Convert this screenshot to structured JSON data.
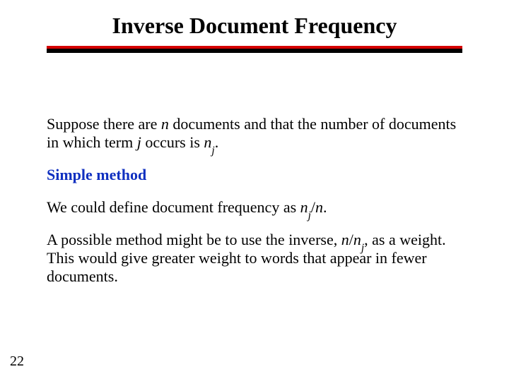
{
  "title": "Inverse Document Frequency",
  "p1_a": "Suppose there are ",
  "p1_b": " documents and that the number of documents in which term ",
  "p1_c": " occurs is ",
  "p1_d": ".",
  "var_n": "n",
  "var_j": "j",
  "var_nj_n": "n",
  "var_nj_j": "j",
  "method_label": "Simple method",
  "p2_a": "We could define document frequency as ",
  "p2_b": "/",
  "p2_c": ".",
  "p3_a": "A possible method might be to use the inverse, ",
  "p3_b": "/",
  "p3_c": ", as a weight.  This would give greater weight to words that appear in fewer documents.",
  "page_number": "22"
}
